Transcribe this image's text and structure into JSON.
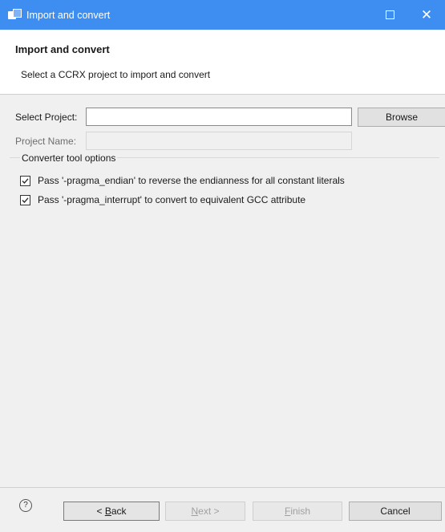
{
  "window": {
    "title": "Import and convert",
    "close_glyph": "✕"
  },
  "banner": {
    "title": "Import and convert",
    "description": "Select a CCRX project to import and convert"
  },
  "form": {
    "select_project_label": "Select Project:",
    "select_project_value": "",
    "browse_label": "Browse",
    "project_name_label": "Project Name:",
    "project_name_value": ""
  },
  "converter_options": {
    "group_title": "Converter tool options",
    "items": [
      {
        "label": "Pass '-pragma_endian' to reverse the endianness for all constant literals",
        "checked": true
      },
      {
        "label": "Pass '-pragma_interrupt' to convert to equivalent GCC attribute",
        "checked": true
      }
    ]
  },
  "footer": {
    "help_glyph": "?",
    "back_prefix": "< ",
    "back_mnemonic": "B",
    "back_rest": "ack",
    "next_mnemonic": "N",
    "next_rest": "ext >",
    "finish_mnemonic": "F",
    "finish_rest": "inish",
    "cancel_label": "Cancel"
  }
}
